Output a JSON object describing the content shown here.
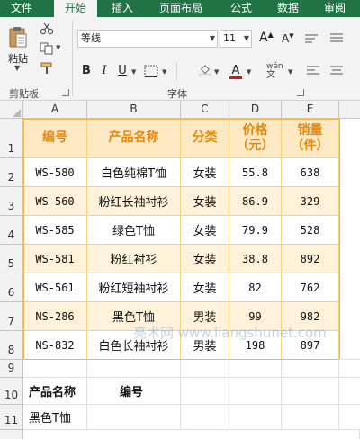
{
  "ribbon": {
    "tabs": [
      "文件",
      "开始",
      "插入",
      "页面布局",
      "公式",
      "数据",
      "审阅"
    ],
    "active_tab": "开始",
    "clipboard": {
      "paste_label": "粘贴",
      "group_label": "剪贴板"
    },
    "font": {
      "name": "等线",
      "size": "11",
      "group_label": "字体",
      "grow": "A",
      "shrink": "A",
      "bold": "B",
      "italic": "I",
      "underline": "U",
      "font_color": "A",
      "phonetic": "wén"
    }
  },
  "columns": [
    "A",
    "B",
    "C",
    "D",
    "E"
  ],
  "rows": [
    "1",
    "2",
    "3",
    "4",
    "5",
    "6",
    "7",
    "8",
    "9",
    "10",
    "11"
  ],
  "table": {
    "headers": {
      "a": "编号",
      "b": "产品名称",
      "c": "分类",
      "d1": "价格",
      "d2": "（元）",
      "e1": "销量",
      "e2": "（件）"
    },
    "data": [
      [
        "WS-580",
        "白色纯棉T恤",
        "女装",
        "55.8",
        "638"
      ],
      [
        "WS-560",
        "粉红长袖衬衫",
        "女装",
        "86.9",
        "329"
      ],
      [
        "WS-585",
        "绿色T恤",
        "女装",
        "79.9",
        "528"
      ],
      [
        "WS-581",
        "粉红衬衫",
        "女装",
        "38.8",
        "892"
      ],
      [
        "WS-561",
        "粉红短袖衬衫",
        "女装",
        "82",
        "762"
      ],
      [
        "NS-286",
        "黑色T恤",
        "男装",
        "99",
        "982"
      ],
      [
        "NS-832",
        "白色长袖衬衫",
        "男装",
        "198",
        "897"
      ]
    ]
  },
  "lookup": {
    "label_name": "产品名称",
    "label_id": "编号",
    "value_name": "黑色T恤",
    "value_id": ""
  },
  "watermark": "亮术网 www.liangshunet.com",
  "colors": {
    "ribbon_green": "#217346",
    "header_fill": "#fde9c4",
    "header_text": "#e8860c",
    "band_fill": "#fef2da",
    "table_border": "#f0b74a"
  }
}
